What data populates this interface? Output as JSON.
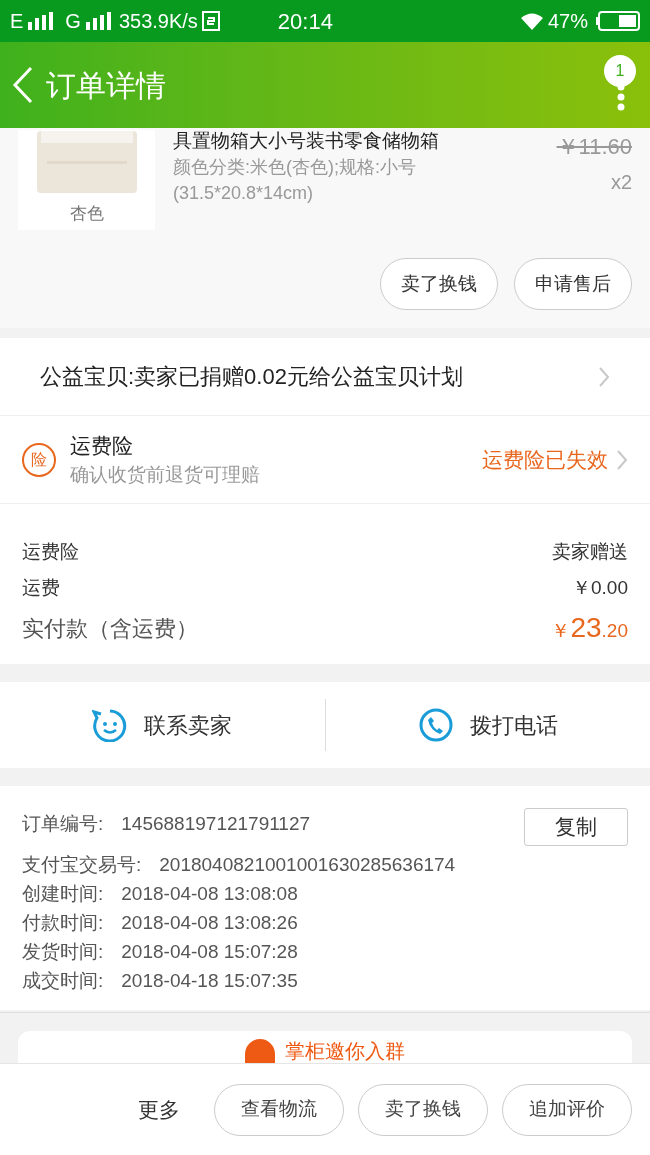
{
  "status_bar": {
    "network_1": "E",
    "network_2": "G",
    "speed": "353.9K/s",
    "time": "20:14",
    "battery": "47%"
  },
  "header": {
    "title": "订单详情",
    "badge": "1"
  },
  "product": {
    "image_label": "杏色",
    "title": "具置物箱大小号装书零食储物箱",
    "sku": "颜色分类:米色(杏色);规格:小号(31.5*20.8*14cm)",
    "original_price": "￥11.60",
    "quantity": "x2",
    "actions": [
      "卖了换钱",
      "申请售后"
    ]
  },
  "charity": {
    "text": "公益宝贝:卖家已捐赠0.02元给公益宝贝计划"
  },
  "insurance": {
    "icon_text": "险",
    "title": "运费险",
    "subtitle": "确认收货前退货可理赔",
    "status": "运费险已失效"
  },
  "summary": {
    "rows": [
      {
        "label": "运费险",
        "value": "卖家赠送"
      },
      {
        "label": "运费",
        "value": "￥0.00"
      }
    ],
    "total_label": "实付款（含运费）",
    "total_currency": "￥",
    "total_integer": "23",
    "total_decimal": ".20"
  },
  "contact": [
    {
      "kind": "chat",
      "label": "联系卖家"
    },
    {
      "kind": "phone",
      "label": "拨打电话"
    }
  ],
  "order_info": {
    "copy_button": "复制",
    "rows": [
      {
        "label": "订单编号:",
        "value": "145688197121791127"
      },
      {
        "label": "支付宝交易号:",
        "value": "2018040821001001630285636174"
      },
      {
        "label": "创建时间:",
        "value": "2018-04-08 13:08:08"
      },
      {
        "label": "付款时间:",
        "value": "2018-04-08 13:08:26"
      },
      {
        "label": "发货时间:",
        "value": "2018-04-08 15:07:28"
      },
      {
        "label": "成交时间:",
        "value": "2018-04-18 15:07:35"
      }
    ]
  },
  "group_card": {
    "text": "掌柜邀你入群"
  },
  "bottom_bar": {
    "more": "更多",
    "buttons": [
      "查看物流",
      "卖了换钱",
      "追加评价"
    ]
  }
}
